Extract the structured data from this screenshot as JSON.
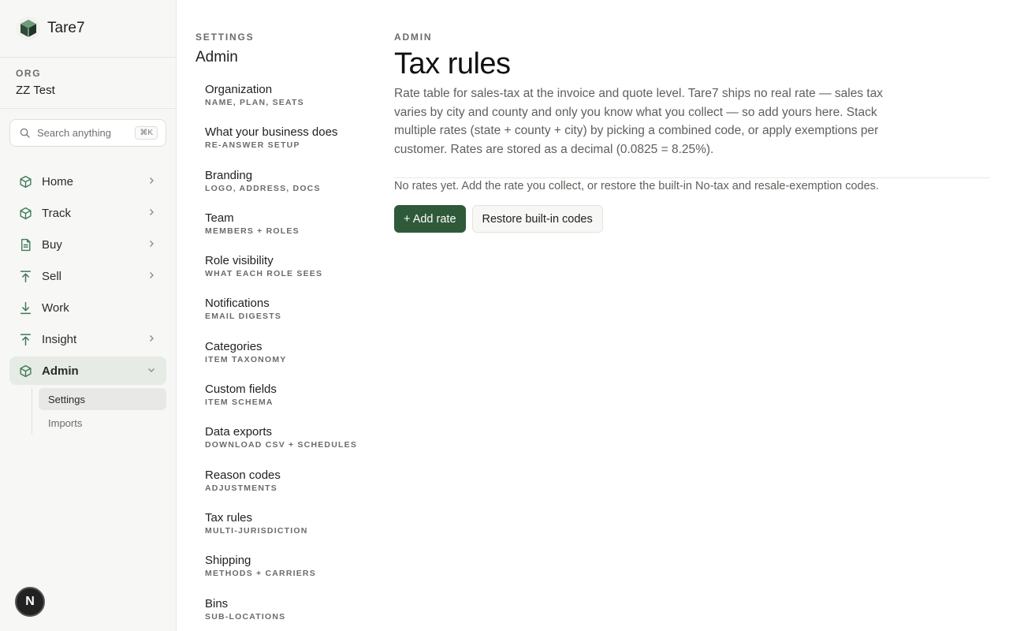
{
  "brand": {
    "name": "Tare7"
  },
  "org": {
    "label": "ORG",
    "name": "ZZ Test"
  },
  "search": {
    "placeholder": "Search anything",
    "shortcut": "⌘K"
  },
  "nav": {
    "items": [
      {
        "label": "Home",
        "icon": "cube-icon"
      },
      {
        "label": "Track",
        "icon": "cube-icon"
      },
      {
        "label": "Buy",
        "icon": "document-icon"
      },
      {
        "label": "Sell",
        "icon": "arrow-up-icon"
      },
      {
        "label": "Work",
        "icon": "arrow-down-icon"
      },
      {
        "label": "Insight",
        "icon": "arrow-up-icon"
      },
      {
        "label": "Admin",
        "icon": "cube-icon"
      }
    ],
    "admin_sub": [
      {
        "label": "Settings"
      },
      {
        "label": "Imports"
      }
    ]
  },
  "user": {
    "initial": "N"
  },
  "settings": {
    "kicker": "SETTINGS",
    "title": "Admin",
    "items": [
      {
        "title": "Organization",
        "sub": "NAME, PLAN, SEATS"
      },
      {
        "title": "What your business does",
        "sub": "RE-ANSWER SETUP"
      },
      {
        "title": "Branding",
        "sub": "LOGO, ADDRESS, DOCS"
      },
      {
        "title": "Team",
        "sub": "MEMBERS + ROLES"
      },
      {
        "title": "Role visibility",
        "sub": "WHAT EACH ROLE SEES"
      },
      {
        "title": "Notifications",
        "sub": "EMAIL DIGESTS"
      },
      {
        "title": "Categories",
        "sub": "ITEM TAXONOMY"
      },
      {
        "title": "Custom fields",
        "sub": "ITEM SCHEMA"
      },
      {
        "title": "Data exports",
        "sub": "DOWNLOAD CSV + SCHEDULES"
      },
      {
        "title": "Reason codes",
        "sub": "ADJUSTMENTS"
      },
      {
        "title": "Tax rules",
        "sub": "MULTI-JURISDICTION"
      },
      {
        "title": "Shipping",
        "sub": "METHODS + CARRIERS"
      },
      {
        "title": "Bins",
        "sub": "SUB-LOCATIONS"
      }
    ]
  },
  "main": {
    "kicker": "ADMIN",
    "title": "Tax rules",
    "description": "Rate table for sales-tax at the invoice and quote level. Tare7 ships no real rate — sales tax varies by city and county and only you know what you collect — so add yours here. Stack multiple rates (state + county + city) by picking a combined code, or apply exemptions per customer. Rates are stored as a decimal (0.0825 = 8.25%).",
    "empty": "No rates yet. Add the rate you collect, or restore the built-in No-tax and resale-exemption codes.",
    "add_label": "+ Add rate",
    "restore_label": "Restore built-in codes"
  },
  "colors": {
    "accent": "#2f5a3a",
    "icon": "#3d7a55"
  }
}
